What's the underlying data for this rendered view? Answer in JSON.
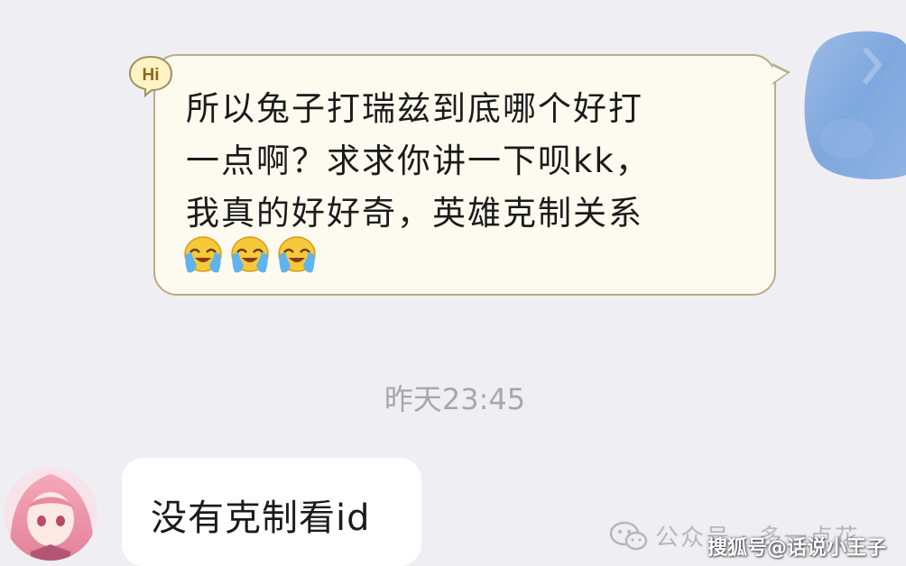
{
  "conversation": {
    "outgoing": {
      "text": "所以兔子打瑞兹到底哪个好打\n一点啊？求求你讲一下呗kk，\n我真的好好奇，英雄克制关系",
      "badge_label": "Hi",
      "emojis": [
        "crying-laughing-emoji",
        "crying-laughing-emoji",
        "crying-laughing-emoji"
      ]
    },
    "timestamp": "昨天23:45",
    "incoming": {
      "text": "没有克制看id"
    }
  },
  "watermarks": {
    "wechat_account": "公众号 · 多一点花",
    "sohu": "搜狐号@话说小王子"
  },
  "colors": {
    "background": "#efeff3",
    "outgoing_bubble": "#fdfbf0",
    "outgoing_border": "#b8ac88",
    "incoming_bubble": "#ffffff",
    "timestamp": "#a6a6ab",
    "self_avatar": "#7fa8de"
  }
}
